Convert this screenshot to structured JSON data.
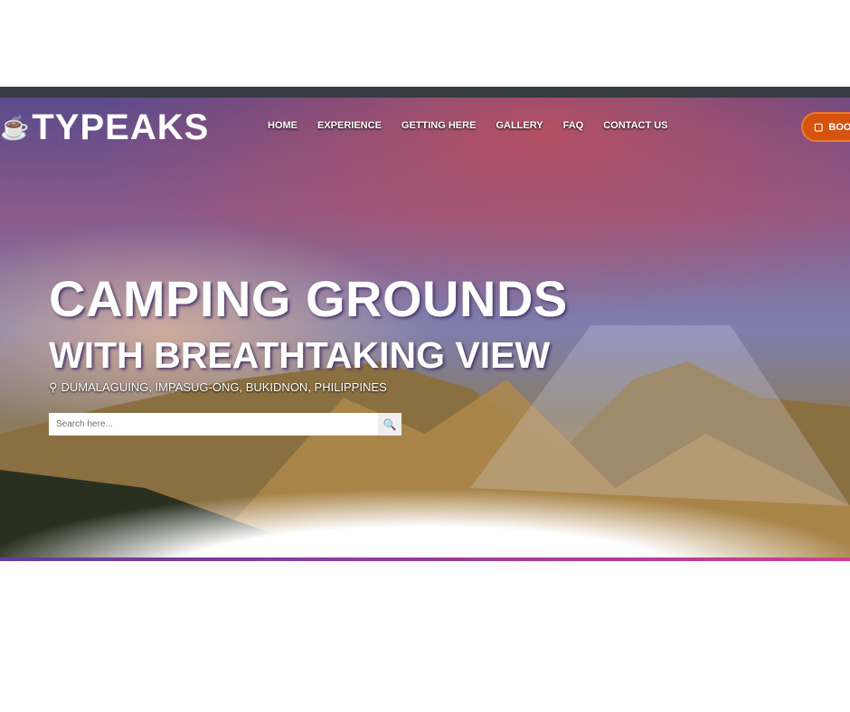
{
  "brand": {
    "logo_text": "TYPEAKS"
  },
  "nav": {
    "items": [
      "Home",
      "Experience",
      "Getting Here",
      "Gallery",
      "FAQ",
      "Contact Us"
    ]
  },
  "book_button": {
    "label": "BOOK"
  },
  "hero": {
    "title_line1": "CAMPING GROUNDS",
    "title_line2": "WITH BREATHTAKING VIEW",
    "location": "Dumalaguing, Impasug-ong, Bukidnon, Philippines"
  },
  "search": {
    "placeholder": "Search here...",
    "value": ""
  }
}
